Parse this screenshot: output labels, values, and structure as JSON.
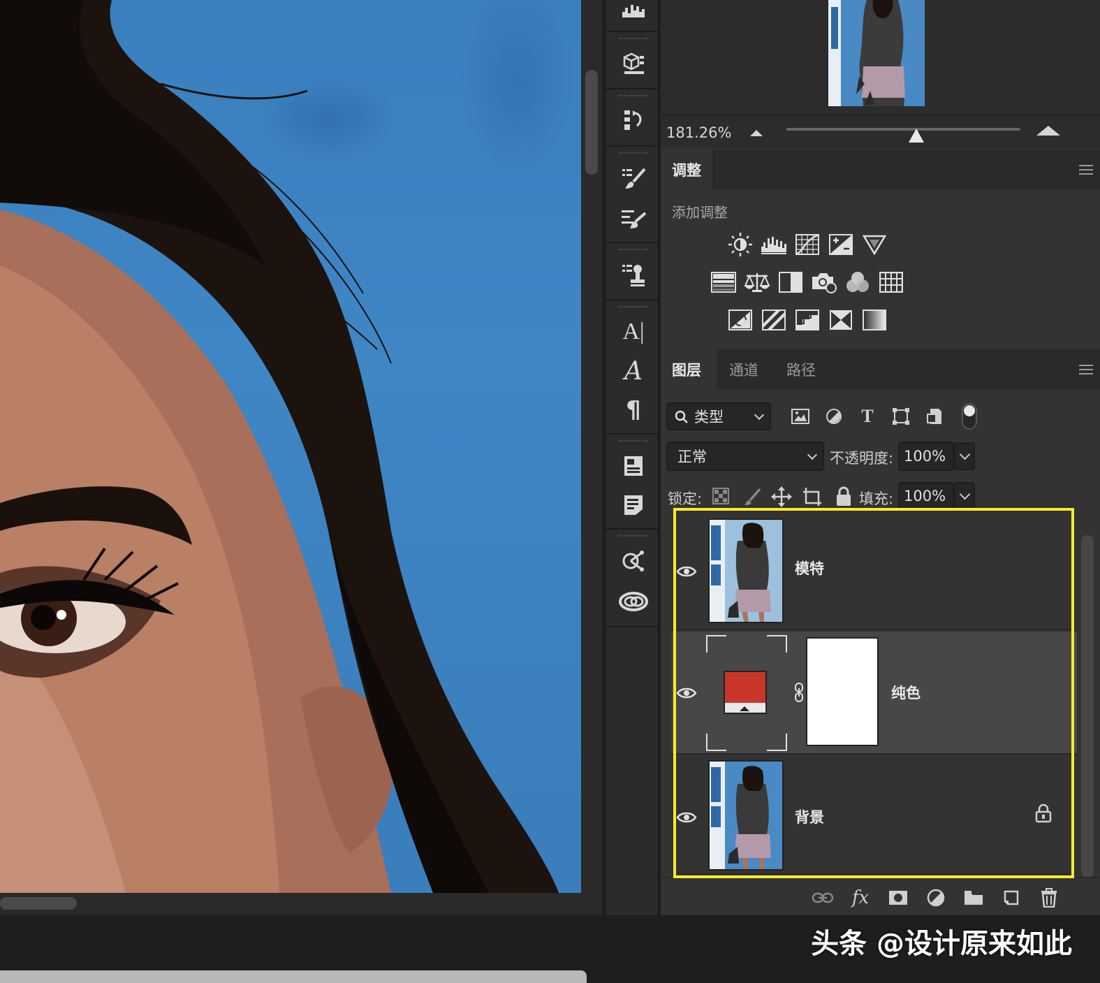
{
  "navigator": {
    "zoom_value": "181.26%"
  },
  "adjustments": {
    "tab_label": "调整",
    "heading": "添加调整",
    "row1_icons": [
      "brightness-contrast-icon",
      "levels-icon",
      "curves-icon",
      "exposure-icon",
      "vibrance-icon"
    ],
    "row2_icons": [
      "hue-saturation-icon",
      "color-balance-icon",
      "black-white-icon",
      "photo-filter-icon",
      "channel-mixer-icon",
      "color-lookup-icon"
    ],
    "row3_icons": [
      "invert-icon",
      "posterize-icon",
      "threshold-icon",
      "selective-color-icon",
      "gradient-map-icon"
    ]
  },
  "layers_panel": {
    "tabs": [
      {
        "label": "图层",
        "active": true
      },
      {
        "label": "通道",
        "active": false
      },
      {
        "label": "路径",
        "active": false
      }
    ],
    "filter_kind": "类型",
    "blend_mode": "正常",
    "opacity_label": "不透明度:",
    "opacity_value": "100%",
    "lock_label": "锁定:",
    "fill_label": "填充:",
    "fill_value": "100%",
    "layers": [
      {
        "name": "模特",
        "visible": true,
        "type": "pixel",
        "locked": false
      },
      {
        "name": "纯色",
        "visible": true,
        "type": "solid-color-fill",
        "fill_color": "#c8352a",
        "selected": true,
        "locked": false
      },
      {
        "name": "背景",
        "visible": true,
        "type": "pixel",
        "locked": true
      }
    ]
  },
  "colors": {
    "highlight": "#f5ec2c",
    "canvas_blue": "#3d82c2",
    "fill_red": "#c8352a"
  },
  "watermark": "头条 @设计原来如此"
}
